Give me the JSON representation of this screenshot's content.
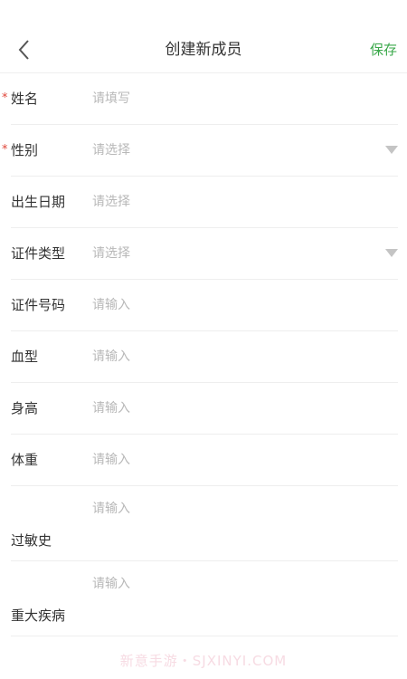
{
  "header": {
    "title": "创建新成员",
    "save_label": "保存",
    "back_icon": "chevron-left-icon"
  },
  "form": {
    "fields": [
      {
        "label": "姓名",
        "placeholder": "请填写",
        "required": true,
        "dropdown": false
      },
      {
        "label": "性别",
        "placeholder": "请选择",
        "required": true,
        "dropdown": true
      },
      {
        "label": "出生日期",
        "placeholder": "请选择",
        "required": false,
        "dropdown": false
      },
      {
        "label": "证件类型",
        "placeholder": "请选择",
        "required": false,
        "dropdown": true
      },
      {
        "label": "证件号码",
        "placeholder": "请输入",
        "required": false,
        "dropdown": false
      },
      {
        "label": "血型",
        "placeholder": "请输入",
        "required": false,
        "dropdown": false
      },
      {
        "label": "身高",
        "placeholder": "请输入",
        "required": false,
        "dropdown": false
      },
      {
        "label": "体重",
        "placeholder": "请输入",
        "required": false,
        "dropdown": false
      },
      {
        "label": "过敏史",
        "placeholder": "请输入",
        "required": false,
        "dropdown": false
      },
      {
        "label": "重大疾病",
        "placeholder": "请输入",
        "required": false,
        "dropdown": false
      }
    ],
    "required_mark": "*",
    "dropdown_icon": "caret-down-icon"
  },
  "watermark": {
    "text": "新意手游・SJXINYI.COM"
  },
  "colors": {
    "accent": "#3aa84a",
    "required": "#e0463a",
    "placeholder": "#b8b8b8",
    "divider": "#eeeeee"
  }
}
